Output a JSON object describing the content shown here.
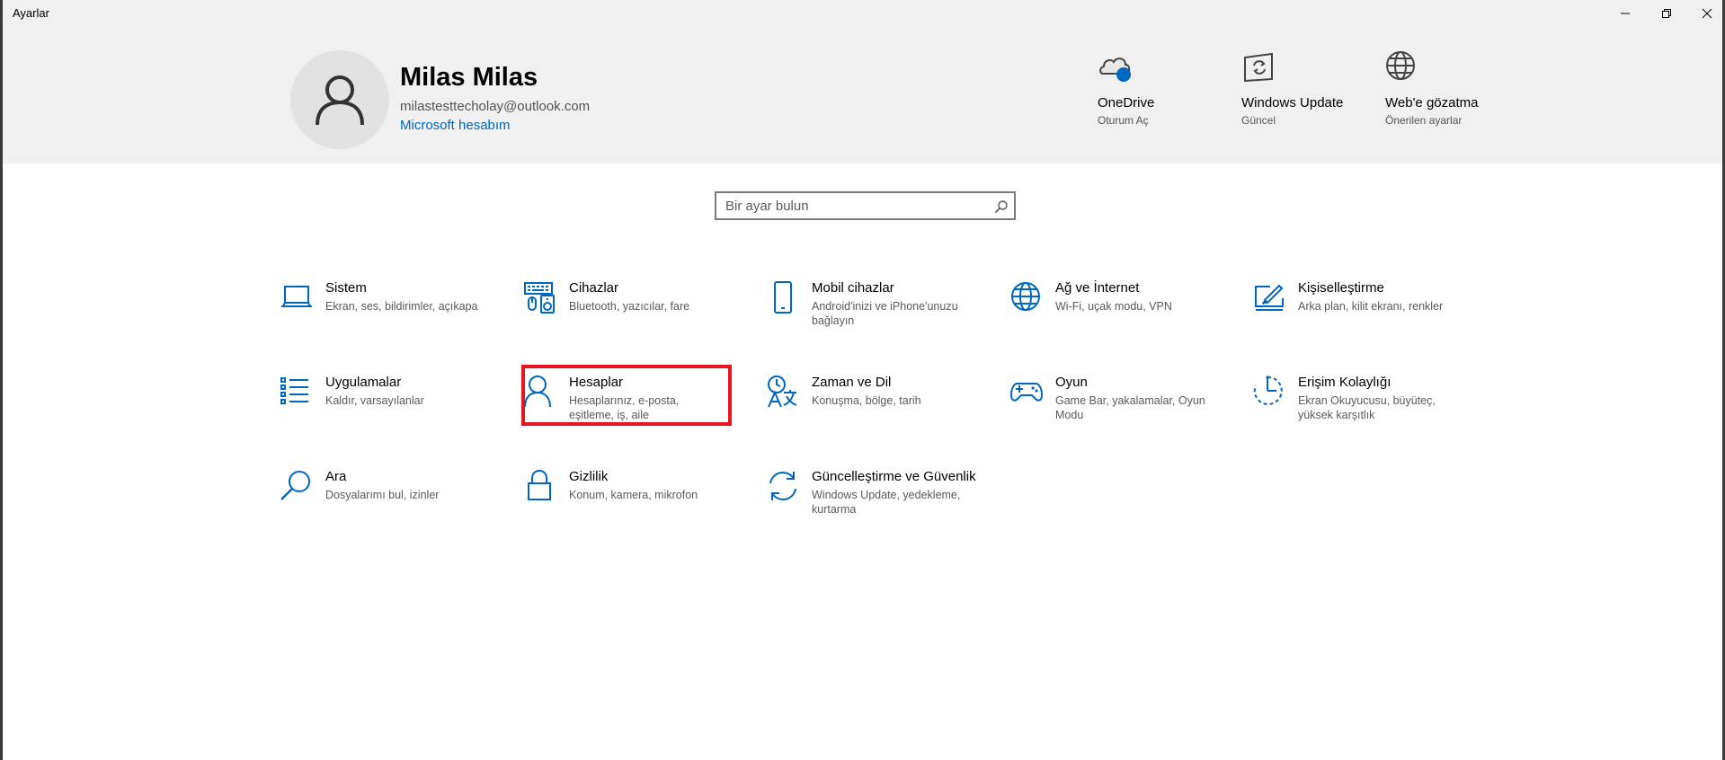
{
  "window": {
    "title": "Ayarlar"
  },
  "user": {
    "name": "Milas Milas",
    "email": "milastesttecholay@outlook.com",
    "account_link": "Microsoft hesabım"
  },
  "header_items": [
    {
      "icon": "onedrive-icon",
      "title": "OneDrive",
      "subtitle": "Oturum Aç"
    },
    {
      "icon": "windows-update-icon",
      "title": "Windows Update",
      "subtitle": "Güncel"
    },
    {
      "icon": "globe-icon",
      "title": "Web'e gözatma",
      "subtitle": "Önerilen ayarlar"
    }
  ],
  "search": {
    "placeholder": "Bir ayar bulun"
  },
  "tiles": [
    {
      "icon": "laptop-icon",
      "title": "Sistem",
      "desc": "Ekran, ses, bildirimler, açıkapa"
    },
    {
      "icon": "devices-icon",
      "title": "Cihazlar",
      "desc": "Bluetooth, yazıcılar, fare"
    },
    {
      "icon": "phone-icon",
      "title": "Mobil cihazlar",
      "desc": "Android'inizi ve iPhone'unuzu bağlayın"
    },
    {
      "icon": "globe-icon",
      "title": "Ağ ve İnternet",
      "desc": "Wi-Fi, uçak modu, VPN"
    },
    {
      "icon": "personalization-icon",
      "title": "Kişiselleştirme",
      "desc": "Arka plan, kilit ekranı, renkler"
    },
    {
      "icon": "apps-list-icon",
      "title": "Uygulamalar",
      "desc": "Kaldır, varsayılanlar"
    },
    {
      "icon": "person-icon",
      "title": "Hesaplar",
      "desc": "Hesaplarınız, e-posta, eşitleme, iş, aile"
    },
    {
      "icon": "time-language-icon",
      "title": "Zaman ve Dil",
      "desc": "Konuşma, bölge, tarih"
    },
    {
      "icon": "gamepad-icon",
      "title": "Oyun",
      "desc": "Game Bar, yakalamalar, Oyun Modu"
    },
    {
      "icon": "ease-of-access-icon",
      "title": "Erişim Kolaylığı",
      "desc": "Ekran Okuyucusu, büyüteç, yüksek karşıtlık"
    },
    {
      "icon": "search-icon",
      "title": "Ara",
      "desc": "Dosyalarımı bul, izinler"
    },
    {
      "icon": "lock-icon",
      "title": "Gizlilik",
      "desc": "Konum, kamera, mikrofon"
    },
    {
      "icon": "update-sync-icon",
      "title": "Güncelleştirme ve Güvenlik",
      "desc": "Windows Update, yedekleme, kurtarma"
    }
  ],
  "colors": {
    "accent": "#0067c0",
    "header_bg": "#f0f0f0",
    "highlight": "#e8141e"
  }
}
